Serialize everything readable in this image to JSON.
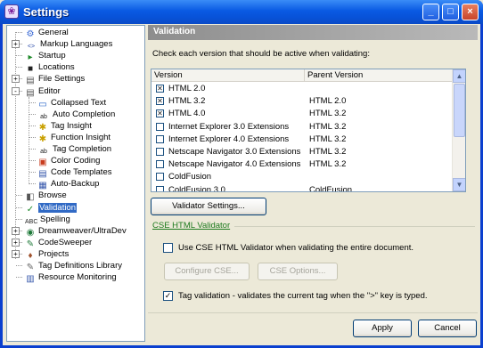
{
  "window": {
    "title": "Settings",
    "minimize": "_",
    "maximize": "□",
    "close": "×"
  },
  "tree": {
    "items": [
      {
        "label": "General",
        "icon": "general-icon",
        "glyph": "⚙",
        "color": "#3b6bd6"
      },
      {
        "label": "Markup Languages",
        "icon": "markup-icon",
        "glyph": "<>",
        "color": "#2a4aa8"
      },
      {
        "label": "Startup",
        "icon": "startup-icon",
        "glyph": "▸",
        "color": "#1f8a2a"
      },
      {
        "label": "Locations",
        "icon": "locations-icon",
        "glyph": "■",
        "color": "#222"
      },
      {
        "label": "File Settings",
        "icon": "file-settings-icon",
        "glyph": "▤",
        "color": "#555"
      },
      {
        "label": "Editor",
        "icon": "editor-icon",
        "glyph": "▤",
        "color": "#555"
      },
      {
        "label": "Collapsed Text",
        "icon": "collapsed-text-icon",
        "glyph": "▭",
        "color": "#1e5cc4"
      },
      {
        "label": "Auto Completion",
        "icon": "auto-completion-icon",
        "glyph": "ab",
        "color": "#222"
      },
      {
        "label": "Tag Insight",
        "icon": "tag-insight-icon",
        "glyph": "✱",
        "color": "#c9a000"
      },
      {
        "label": "Function Insight",
        "icon": "function-insight-icon",
        "glyph": "✱",
        "color": "#c9a000"
      },
      {
        "label": "Tag Completion",
        "icon": "tag-completion-icon",
        "glyph": "ab",
        "color": "#222"
      },
      {
        "label": "Color Coding",
        "icon": "color-coding-icon",
        "glyph": "▣",
        "color": "#c83c1e"
      },
      {
        "label": "Code Templates",
        "icon": "code-templates-icon",
        "glyph": "▤",
        "color": "#3355aa"
      },
      {
        "label": "Auto-Backup",
        "icon": "auto-backup-icon",
        "glyph": "▦",
        "color": "#3355aa"
      },
      {
        "label": "Browse",
        "icon": "browse-icon",
        "glyph": "◧",
        "color": "#555"
      },
      {
        "label": "Validation",
        "icon": "validation-icon",
        "glyph": "✓",
        "color": "#1f8a2a"
      },
      {
        "label": "Spelling",
        "icon": "spelling-icon",
        "glyph": "ABC",
        "color": "#222"
      },
      {
        "label": "Dreamweaver/UltraDev",
        "icon": "dreamweaver-icon",
        "glyph": "◉",
        "color": "#1f7a3a"
      },
      {
        "label": "CodeSweeper",
        "icon": "codesweeper-icon",
        "glyph": "✎",
        "color": "#1f7a3a"
      },
      {
        "label": "Projects",
        "icon": "projects-icon",
        "glyph": "♦",
        "color": "#a0522d"
      },
      {
        "label": "Tag Definitions Library",
        "icon": "tag-definitions-icon",
        "glyph": "✎",
        "color": "#666"
      },
      {
        "label": "Resource Monitoring",
        "icon": "resource-monitoring-icon",
        "glyph": "▥",
        "color": "#3355aa"
      }
    ]
  },
  "panel": {
    "header": "Validation",
    "instruction": "Check each version that should be active when validating:",
    "columns": [
      "Version",
      "Parent Version"
    ],
    "rows": [
      {
        "version": "HTML 2.0",
        "parent": "",
        "checked": true
      },
      {
        "version": "HTML 3.2",
        "parent": "HTML 2.0",
        "checked": true
      },
      {
        "version": "HTML 4.0",
        "parent": "HTML 3.2",
        "checked": true
      },
      {
        "version": "Internet Explorer 3.0 Extensions",
        "parent": "HTML 3.2",
        "checked": false
      },
      {
        "version": "Internet Explorer 4.0 Extensions",
        "parent": "HTML 3.2",
        "checked": false
      },
      {
        "version": "Netscape Navigator 3.0 Extensions",
        "parent": "HTML 3.2",
        "checked": false
      },
      {
        "version": "Netscape Navigator 4.0 Extensions",
        "parent": "HTML 3.2",
        "checked": false
      },
      {
        "version": "ColdFusion",
        "parent": "",
        "checked": false
      },
      {
        "version": "ColdFusion 3.0",
        "parent": "ColdFusion",
        "checked": false
      }
    ],
    "validator_settings": "Validator Settings...",
    "cse_link": "CSE HTML Validator",
    "use_cse_label": "Use CSE HTML Validator when validating the entire document.",
    "use_cse_checked": false,
    "configure_cse": "Configure CSE...",
    "cse_options": "CSE Options...",
    "tag_validation_label": "Tag validation - validates the current tag when the \">\" key is typed.",
    "tag_validation_checked": true
  },
  "footer": {
    "apply": "Apply",
    "cancel": "Cancel"
  }
}
